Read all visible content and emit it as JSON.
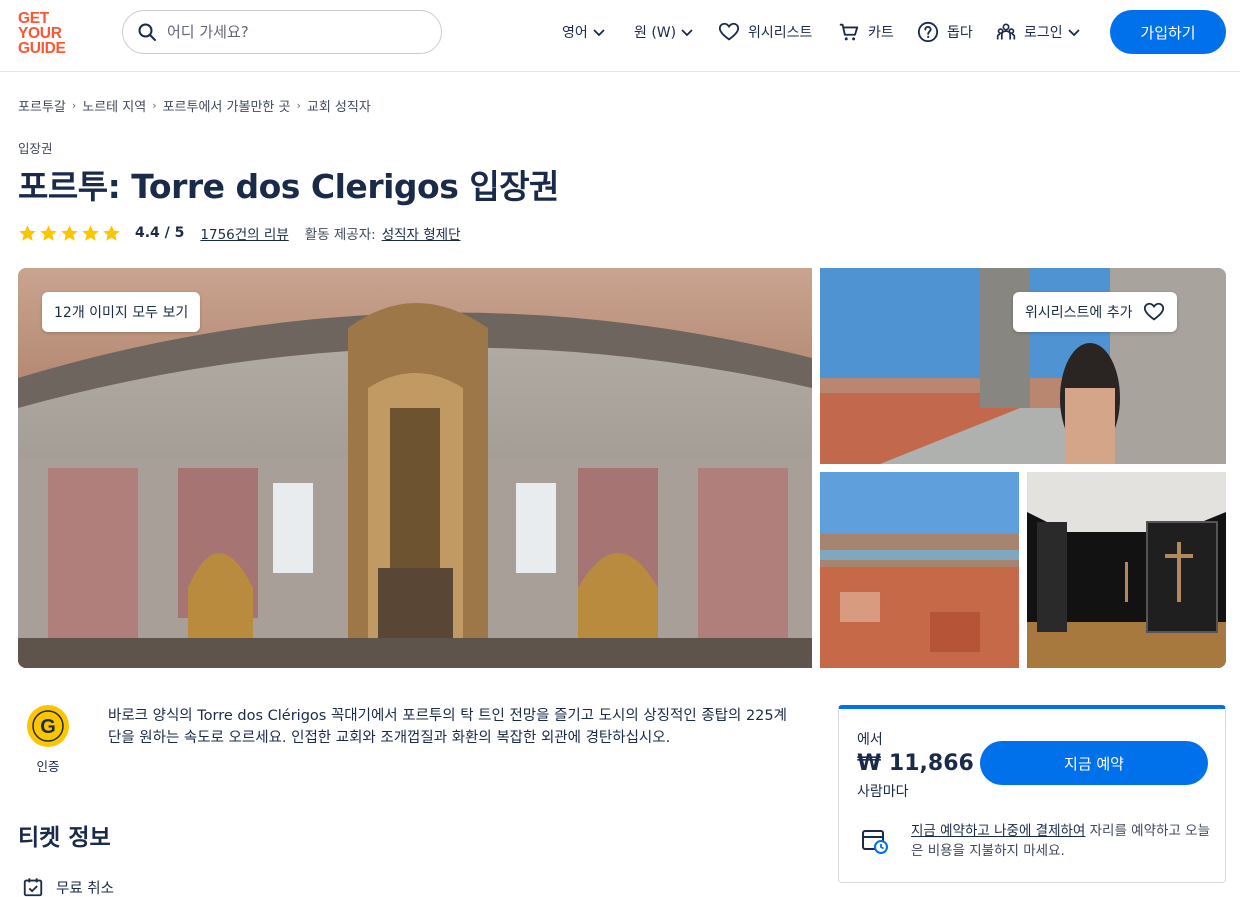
{
  "brand": {
    "logo_lines": [
      "GET",
      "YOUR",
      "GUIDE"
    ],
    "color": "#ff5533"
  },
  "accent": "#0071eb",
  "header": {
    "search_placeholder": "어디 가세요?",
    "language": "영어",
    "currency": "원 (W)",
    "wishlist": "위시리스트",
    "cart": "카트",
    "help": "돕다",
    "login": "로그인",
    "signup": "가입하기"
  },
  "breadcrumb": [
    "포르투갈",
    "노르테 지역",
    "포르투에서 가볼만한 곳",
    "교회 성직자"
  ],
  "product": {
    "category": "입장권",
    "title": "포르투: Torre dos Clerigos 입장권",
    "rating": 4.4,
    "rating_text": "4.4 / 5",
    "reviews_text": "1756건의 리뷰",
    "provider_label": "활동 제공자:",
    "provider": "성직자 형제단"
  },
  "gallery": {
    "view_all": "12개 이미지 모두 보기",
    "wishlist_add": "위시리스트에 추가"
  },
  "certified": {
    "badge_letter": "G",
    "label": "인증"
  },
  "description": "바로크 양식의 Torre dos Clérigos 꼭대기에서 포르투의 탁 트인 전망을 즐기고 도시의 상징적인 종탑의 225계단을 원하는 속도로 오르세요. 인접한 교회와 조개껍질과 화환의 복잡한 외관에 경탄하십시오.",
  "ticket_info": {
    "title": "티켓 정보",
    "free_cancel": "무료 취소"
  },
  "booking": {
    "from_label": "에서",
    "price": "₩ 11,866",
    "per_person": "사람마다",
    "book_now": "지금 예약",
    "rnpl_link": "지금 예약하고 나중에 결제하여",
    "rnpl_rest": " 자리를 예약하고 오늘은 비용을 지불하지 마세요."
  }
}
